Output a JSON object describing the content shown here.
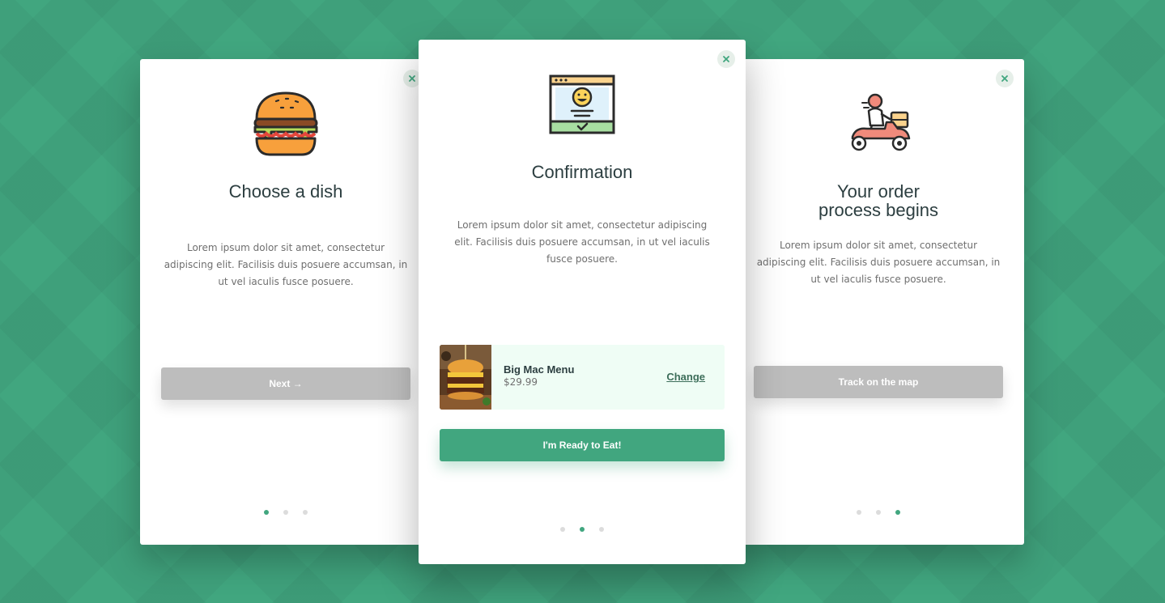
{
  "colors": {
    "background": "#41a67f",
    "accent": "#41a67f",
    "button_disabled": "#bdbdbd",
    "order_bg": "#effdf5"
  },
  "cards": {
    "left": {
      "icon": "burger-icon",
      "title": "Choose a dish",
      "description": "Lorem ipsum dolor sit amet, consectetur adipiscing elit. Facilisis duis posuere accumsan, in ut vel iaculis fusce posuere.",
      "button_label": "Next →",
      "close_icon": "close-icon",
      "dots": {
        "count": 3,
        "active_index": 0
      }
    },
    "center": {
      "icon": "browser-smiley-icon",
      "title": "Confirmation",
      "description": "Lorem ipsum dolor sit amet, consectetur adipiscing elit. Facilisis duis posuere accumsan, in ut vel iaculis fusce posuere.",
      "order": {
        "name": "Big Mac Menu",
        "price": "$29.99",
        "change_label": "Change",
        "image": "burger-photo"
      },
      "button_label": "I'm Ready to Eat!",
      "close_icon": "close-icon",
      "dots": {
        "count": 3,
        "active_index": 1
      }
    },
    "right": {
      "icon": "delivery-scooter-icon",
      "title_line1": "Your order",
      "title_line2": "process begins",
      "description": "Lorem ipsum dolor sit amet, consectetur adipiscing elit. Facilisis duis posuere accumsan, in ut vel iaculis fusce posuere.",
      "button_label": "Track on the map",
      "close_icon": "close-icon",
      "dots": {
        "count": 3,
        "active_index": 2
      }
    }
  }
}
